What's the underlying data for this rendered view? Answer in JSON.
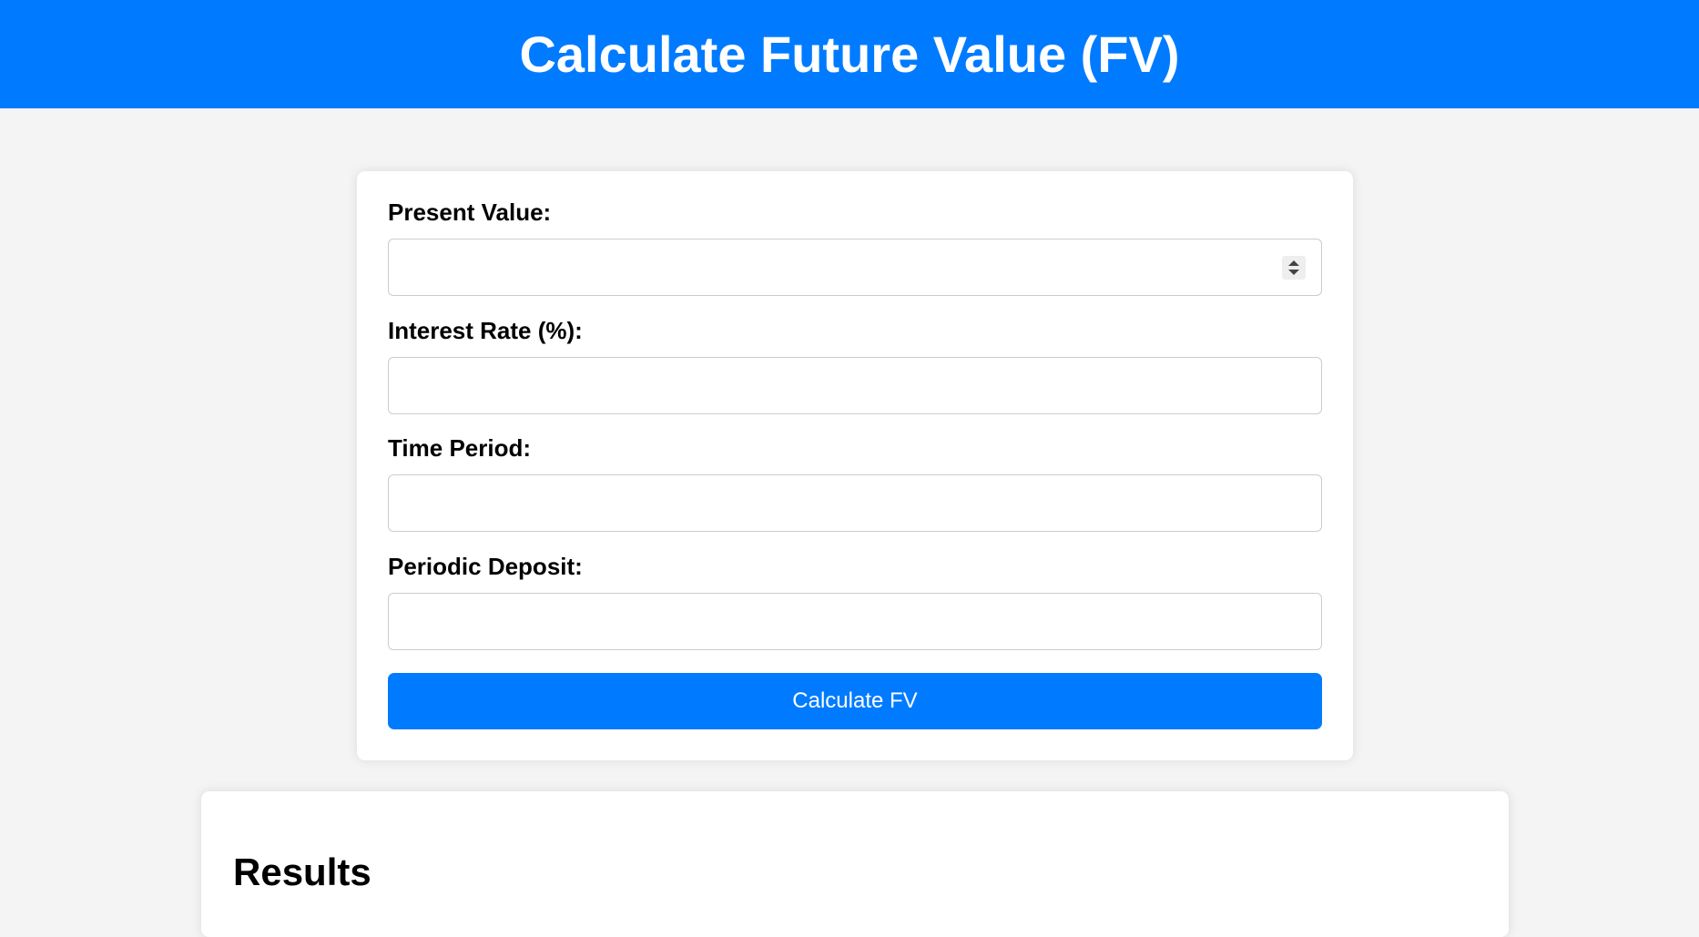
{
  "header": {
    "title": "Calculate Future Value (FV)"
  },
  "form": {
    "present_value": {
      "label": "Present Value:",
      "value": "",
      "placeholder": ""
    },
    "interest_rate": {
      "label": "Interest Rate (%):",
      "value": "",
      "placeholder": ""
    },
    "time_period": {
      "label": "Time Period:",
      "value": "",
      "placeholder": ""
    },
    "periodic_deposit": {
      "label": "Periodic Deposit:",
      "value": "",
      "placeholder": ""
    },
    "submit_label": "Calculate FV"
  },
  "results": {
    "title": "Results"
  },
  "colors": {
    "accent": "#007bff",
    "background": "#f4f4f4",
    "card": "#ffffff"
  }
}
